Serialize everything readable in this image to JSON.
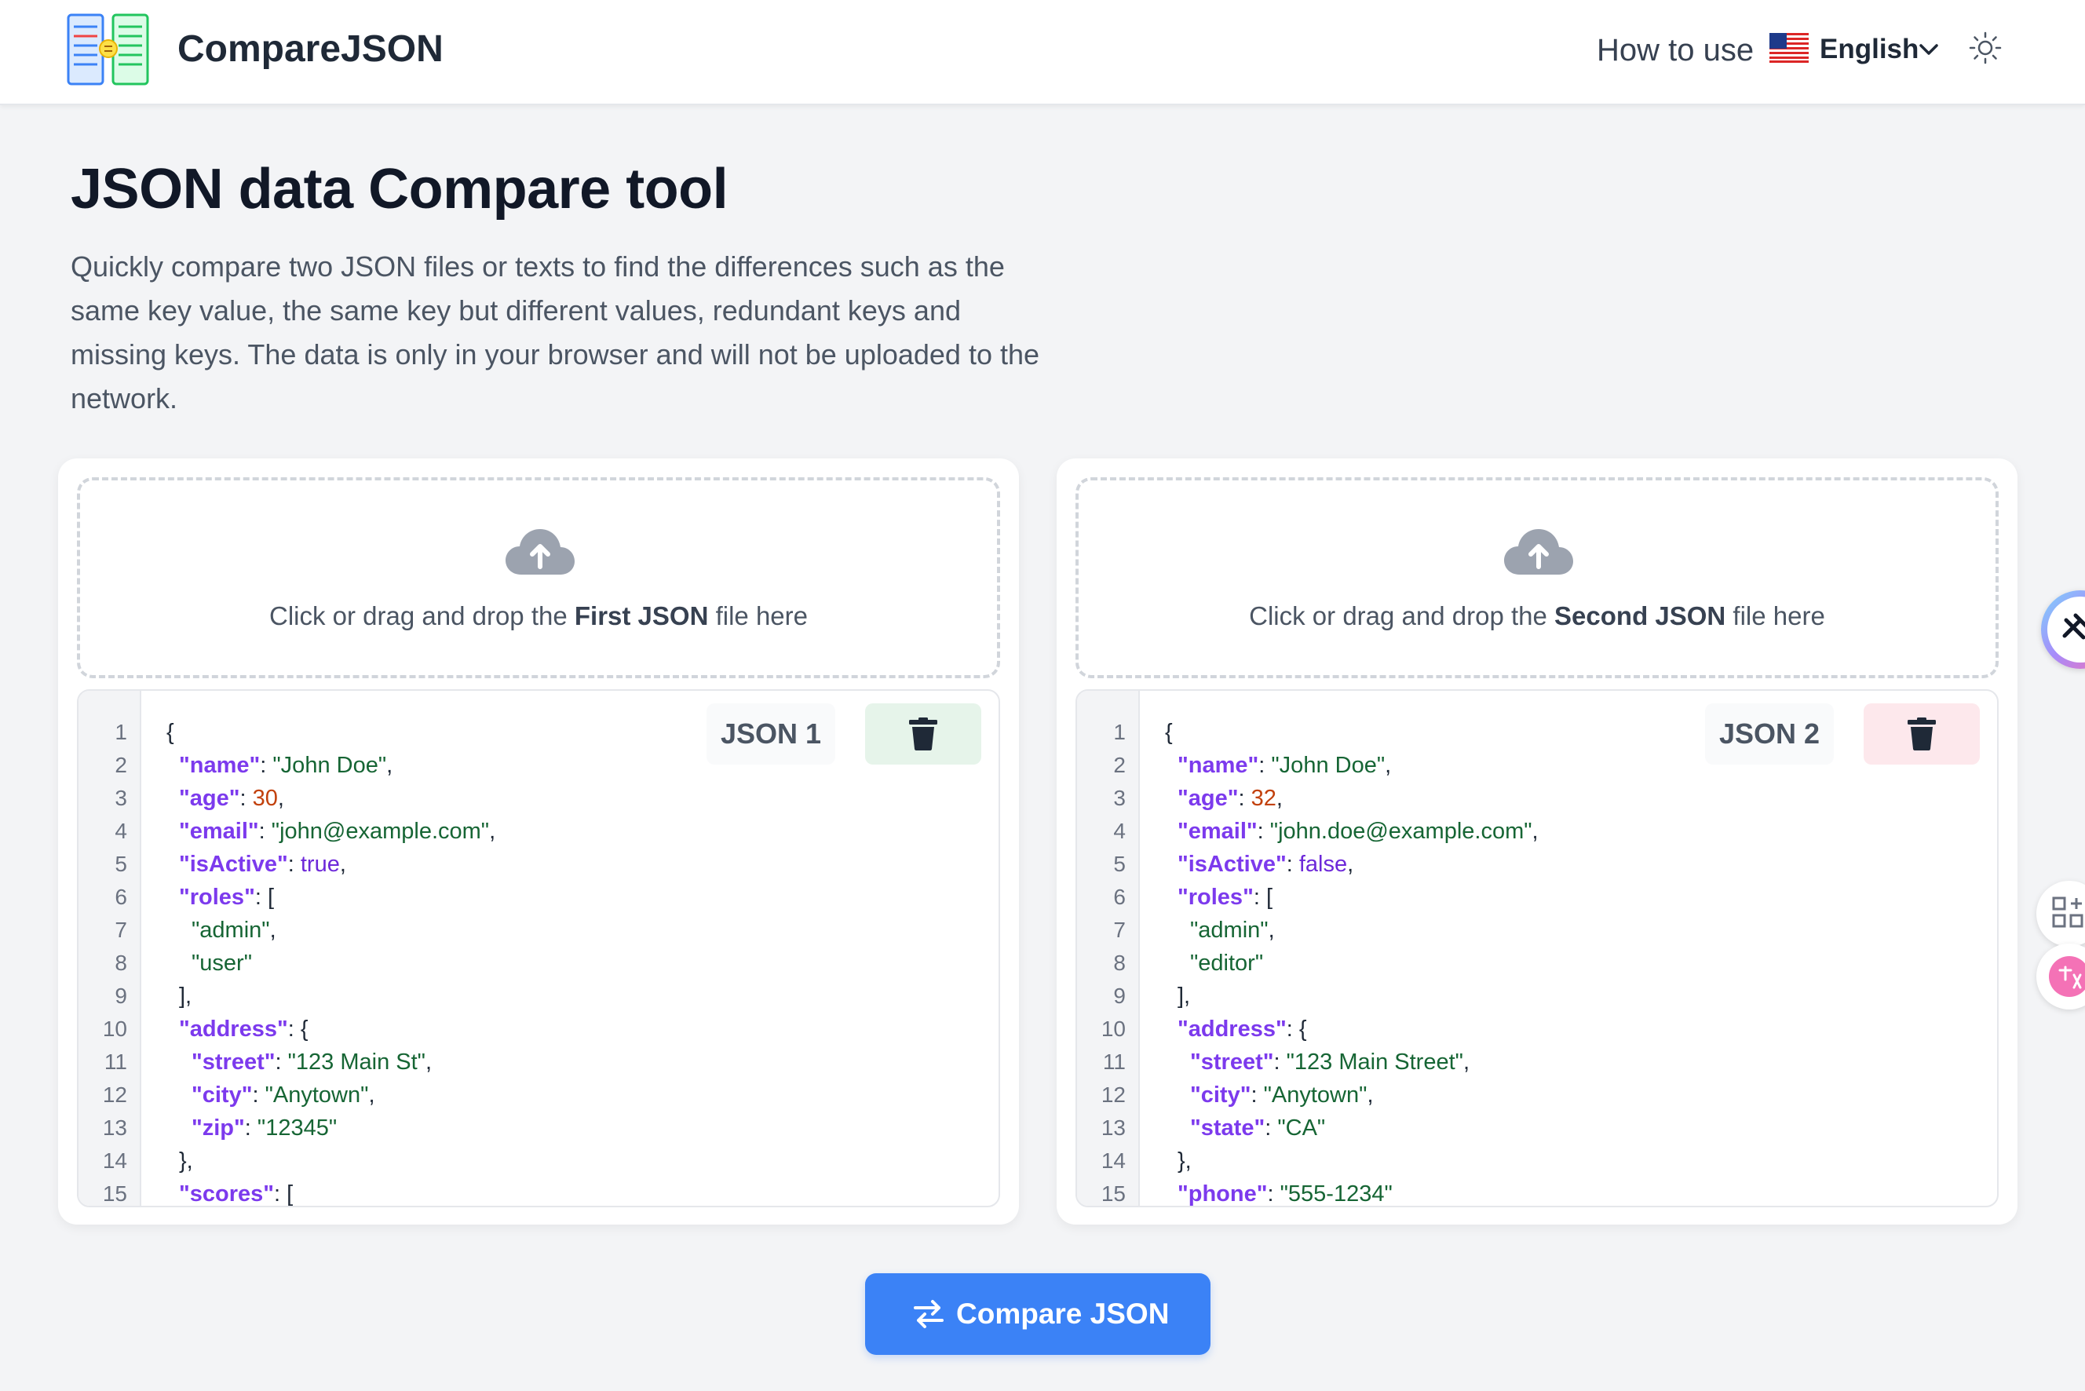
{
  "header": {
    "brand": "CompareJSON",
    "nav_howto": "How to use",
    "language": "English",
    "icons": {
      "logo": "compare-json-logo",
      "flag": "us-flag-icon",
      "chevron": "chevron-down-icon",
      "theme": "sun-icon"
    }
  },
  "hero": {
    "title": "JSON data Compare tool",
    "description": "Quickly compare two JSON files or texts to find the differences such as the same key value, the same key but different values, redundant keys and missing keys. The data is only in your browser and will not be uploaded to the network."
  },
  "panels": {
    "left": {
      "drop_prefix": "Click or drag and drop the ",
      "drop_bold": "First JSON",
      "drop_suffix": " file here",
      "tag": "JSON 1",
      "line_numbers": [
        "1",
        "2",
        "3",
        "4",
        "5",
        "6",
        "7",
        "8",
        "9",
        "10",
        "11",
        "12",
        "13",
        "14",
        "15"
      ]
    },
    "right": {
      "drop_prefix": "Click or drag and drop the ",
      "drop_bold": "Second JSON",
      "drop_suffix": " file here",
      "tag": "JSON 2",
      "line_numbers": [
        "1",
        "2",
        "3",
        "4",
        "5",
        "6",
        "7",
        "8",
        "9",
        "10",
        "11",
        "12",
        "13",
        "14",
        "15"
      ]
    }
  },
  "json1": {
    "open": "{",
    "name_key": "\"name\"",
    "name_val": "\"John Doe\"",
    "age_key": "\"age\"",
    "age_val": "30",
    "email_key": "\"email\"",
    "email_val": "\"john@example.com\"",
    "active_key": "\"isActive\"",
    "active_val": "true",
    "roles_key": "\"roles\"",
    "roles_open": "[",
    "role1": "\"admin\"",
    "role2": "\"user\"",
    "roles_close": "],",
    "address_key": "\"address\"",
    "address_open": "{",
    "street_key": "\"street\"",
    "street_val": "\"123 Main St\"",
    "city_key": "\"city\"",
    "city_val": "\"Anytown\"",
    "zip_key": "\"zip\"",
    "zip_val": "\"12345\"",
    "address_close": "},",
    "scores_key": "\"scores\"",
    "scores_open": "["
  },
  "json2": {
    "open": "{",
    "name_key": "\"name\"",
    "name_val": "\"John Doe\"",
    "age_key": "\"age\"",
    "age_val": "32",
    "email_key": "\"email\"",
    "email_val": "\"john.doe@example.com\"",
    "active_key": "\"isActive\"",
    "active_val": "false",
    "roles_key": "\"roles\"",
    "roles_open": "[",
    "role1": "\"admin\"",
    "role2": "\"editor\"",
    "roles_close": "],",
    "address_key": "\"address\"",
    "address_open": "{",
    "street_key": "\"street\"",
    "street_val": "\"123 Main Street\"",
    "city_key": "\"city\"",
    "city_val": "\"Anytown\"",
    "state_key": "\"state\"",
    "state_val": "\"CA\"",
    "address_close": "},",
    "phone_key": "\"phone\"",
    "phone_val": "\"555-1234\""
  },
  "compare": {
    "label": "Compare JSON",
    "icon": "swap-arrows-icon"
  },
  "colors": {
    "accent": "#3b82f6",
    "json_key": "#7c3aed",
    "json_string": "#166534",
    "json_number": "#c2410c",
    "trash_left_bg": "#e6f4ea",
    "trash_right_bg": "#fde8ec"
  }
}
